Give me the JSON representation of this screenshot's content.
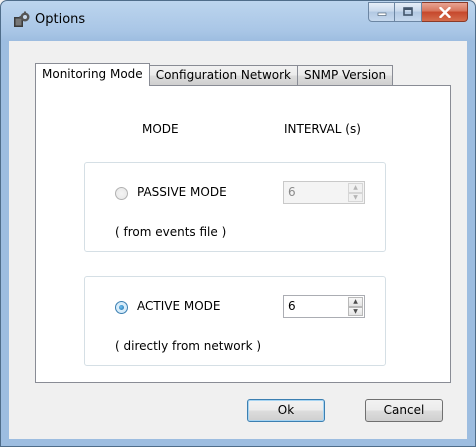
{
  "window": {
    "title": "Options"
  },
  "tabs": [
    "Monitoring Mode",
    "Configuration Network",
    "SNMP Version"
  ],
  "headers": {
    "mode": "MODE",
    "interval": "INTERVAL (s)"
  },
  "passive": {
    "label": "PASSIVE MODE",
    "sublabel": "( from events file )",
    "interval": "6",
    "selected": false,
    "enabled": false
  },
  "active": {
    "label": "ACTIVE MODE",
    "sublabel": "( directly from network )",
    "interval": "6",
    "selected": true,
    "enabled": true
  },
  "buttons": {
    "ok": "Ok",
    "cancel": "Cancel"
  },
  "icons": {
    "app": "options-icon",
    "spin_up": "up-arrow-icon",
    "spin_down": "down-arrow-icon"
  }
}
